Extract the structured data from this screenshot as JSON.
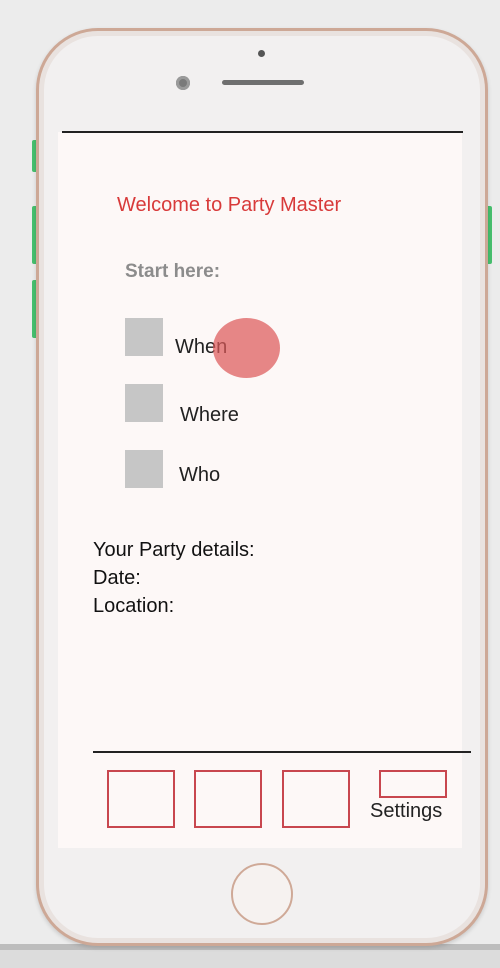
{
  "app": {
    "welcome": "Welcome to Party Master",
    "start_prompt": "Start here:"
  },
  "options": [
    {
      "label": "When",
      "checked": false
    },
    {
      "label": "Where",
      "checked": false
    },
    {
      "label": "Who",
      "checked": false
    }
  ],
  "details": {
    "heading": "Your Party details:",
    "date_label": "Date:",
    "location_label": "Location:"
  },
  "nav": {
    "settings_label": "Settings"
  },
  "icons": {
    "camera": "camera-icon",
    "speaker": "speaker-icon",
    "home": "home-button-icon"
  },
  "colors": {
    "accent": "#d83a3a",
    "nav_border": "#c8474f",
    "checkbox": "#c6c6c6",
    "phone_frame": "#cda896",
    "side_buttons": "#47c06e"
  }
}
